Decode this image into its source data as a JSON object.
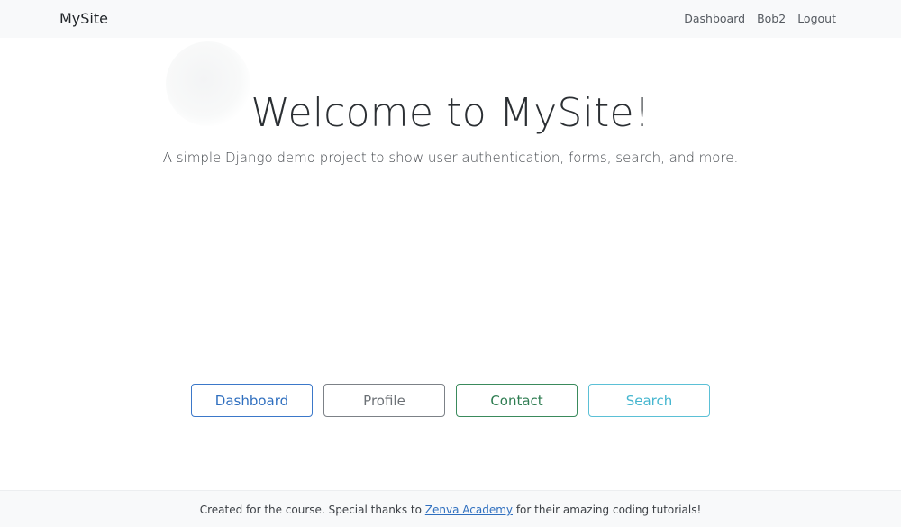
{
  "navbar": {
    "brand": "MySite",
    "links": [
      {
        "label": "Dashboard"
      },
      {
        "label": "Bob2"
      },
      {
        "label": "Logout"
      }
    ]
  },
  "hero": {
    "title": "Welcome to MySite!",
    "lead": "A simple Django demo project to show user authentication, forms, search, and more."
  },
  "buttons": [
    {
      "label": "Dashboard",
      "variant": "primary"
    },
    {
      "label": "Profile",
      "variant": "secondary"
    },
    {
      "label": "Contact",
      "variant": "success"
    },
    {
      "label": "Search",
      "variant": "info"
    }
  ],
  "footer": {
    "text_before": "Created for the course. Special thanks to ",
    "link_label": "Zenva Academy",
    "text_after": " for their amazing coding tutorials!"
  },
  "colors": {
    "primary": "#2f6fbf",
    "secondary": "#6c7176",
    "success": "#2f7d52",
    "info": "#45b6cf",
    "navbar_bg": "#f8f9fa"
  }
}
